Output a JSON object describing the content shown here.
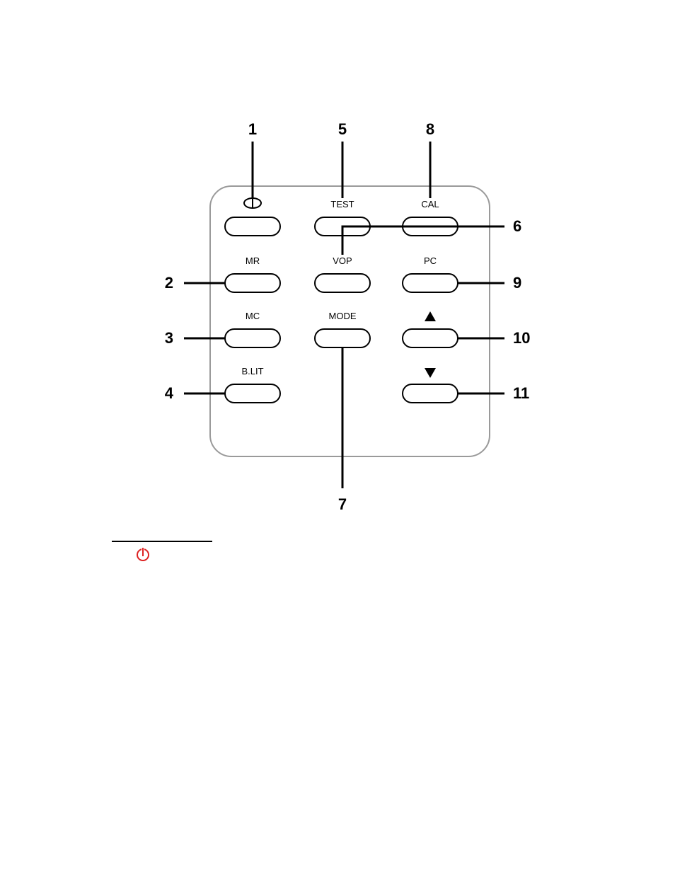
{
  "keypad": {
    "labels": {
      "power": "",
      "test": "TEST",
      "cal": "CAL",
      "mr": "MR",
      "vop": "VOP",
      "pc": "PC",
      "mc": "MC",
      "mode": "MODE",
      "blit": "B.LIT"
    }
  },
  "callouts": {
    "n1": "1",
    "n2": "2",
    "n3": "3",
    "n4": "4",
    "n5": "5",
    "n6": "6",
    "n7": "7",
    "n8": "8",
    "n9": "9",
    "n10": "10",
    "n11": "11"
  }
}
